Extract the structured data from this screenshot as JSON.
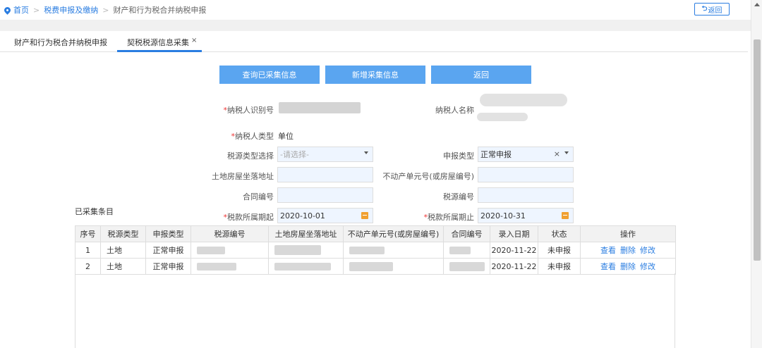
{
  "breadcrumb": {
    "home": "首页",
    "level2": "税费申报及缴纳",
    "current": "财产和行为税合并纳税申报"
  },
  "back_top_label": "返回",
  "tabs": [
    {
      "label": "财产和行为税合并纳税申报"
    },
    {
      "label": "契税税源信息采集",
      "close": "×"
    }
  ],
  "buttons": {
    "query": "查询已采集信息",
    "add": "新增采集信息",
    "back": "返回"
  },
  "form": {
    "taxpayer_id_label": "纳税人识别号",
    "taxpayer_name_label": "纳税人名称",
    "taxpayer_type_label": "纳税人类型",
    "taxpayer_type_value": "单位",
    "source_type_label": "税源类型选择",
    "source_type_placeholder": "-请选择-",
    "declare_type_label": "申报类型",
    "declare_type_value": "正常申报",
    "address_label": "土地房屋坐落地址",
    "property_unit_label": "不动产单元号(或房屋编号)",
    "contract_label": "合同编号",
    "source_no_label": "税源编号",
    "period_start_label": "税款所属期起",
    "period_start_value": "2020-10-01",
    "period_end_label": "税款所属期止",
    "period_end_value": "2020-10-31",
    "required_mark": "*"
  },
  "section_title": "已采集条目",
  "table": {
    "headers": [
      "序号",
      "税源类型",
      "申报类型",
      "税源编号",
      "土地房屋坐落地址",
      "不动产单元号(或房屋编号)",
      "合同编号",
      "录入日期",
      "状态",
      "操作"
    ],
    "rows": [
      {
        "no": "1",
        "source_type": "土地",
        "declare_type": "正常申报",
        "entry_date": "2020-11-22",
        "status": "未申报"
      },
      {
        "no": "2",
        "source_type": "土地",
        "declare_type": "正常申报",
        "entry_date": "2020-11-22",
        "status": "未申报"
      }
    ],
    "ops": {
      "view": "查看",
      "delete": "删除",
      "edit": "修改"
    }
  },
  "colors": {
    "accent": "#2a7de1",
    "button": "#5aa5f0",
    "required": "#e33"
  }
}
